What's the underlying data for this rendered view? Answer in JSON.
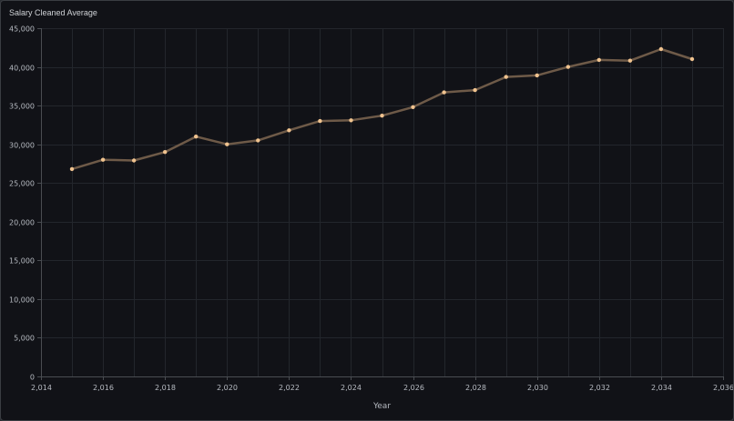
{
  "panel": {
    "title": "Salary Cleaned Average"
  },
  "chart_data": {
    "type": "line",
    "title": "Salary Cleaned Average",
    "xlabel": "Year",
    "ylabel": "",
    "xlim": [
      2014,
      2036
    ],
    "ylim": [
      0,
      45000
    ],
    "x_ticks": [
      2014,
      2016,
      2018,
      2020,
      2022,
      2024,
      2026,
      2028,
      2030,
      2032,
      2034,
      2036
    ],
    "y_ticks": [
      0,
      5000,
      10000,
      15000,
      20000,
      25000,
      30000,
      35000,
      40000,
      45000
    ],
    "grid": true,
    "legend": "none",
    "colors": {
      "line": "#6e5a48",
      "point": "#f0c38f",
      "grid": "#23262c",
      "axis": "#4a4d52"
    },
    "x": [
      2015,
      2016,
      2017,
      2018,
      2019,
      2020,
      2021,
      2022,
      2023,
      2024,
      2025,
      2026,
      2027,
      2028,
      2029,
      2030,
      2031,
      2032,
      2033,
      2034,
      2035
    ],
    "series": [
      {
        "values": [
          26800,
          28000,
          27900,
          29000,
          31000,
          30000,
          30500,
          31800,
          33000,
          33100,
          33700,
          34800,
          36700,
          37000,
          38700,
          38900,
          40000,
          40900,
          40800,
          42300,
          41000
        ]
      }
    ]
  }
}
